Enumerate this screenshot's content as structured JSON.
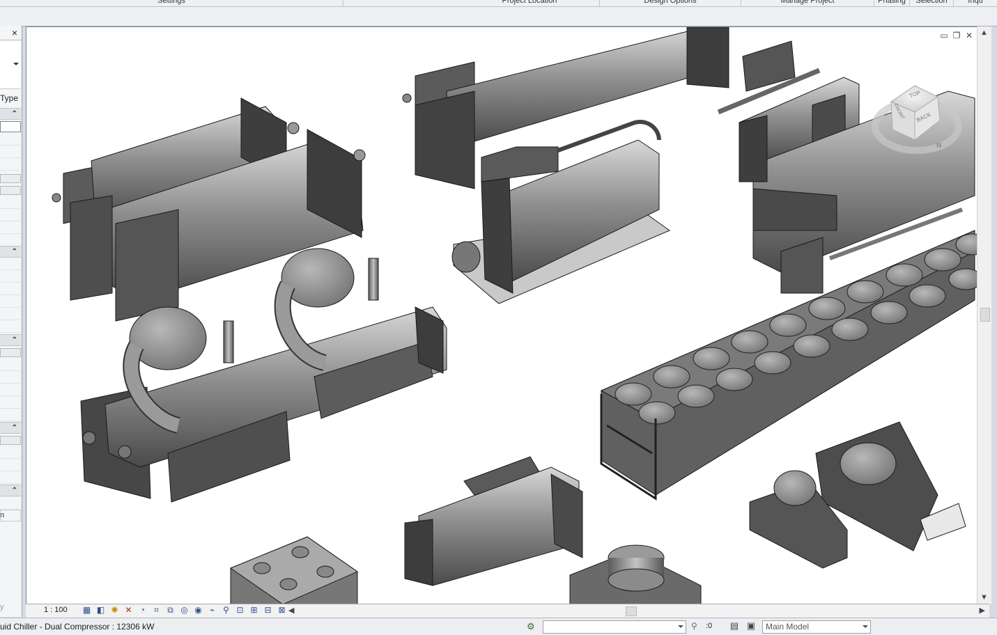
{
  "ribbon": {
    "tabs": [
      "Settings",
      "Project Location",
      "Design Options",
      "Manage Project",
      "Phasing",
      "Selection",
      "Inqu"
    ]
  },
  "properties": {
    "close_label": "×",
    "type_label": "Type",
    "section_toggle": "⌃",
    "partial_value_1": "n",
    "partial_value_2": "y"
  },
  "view": {
    "window_buttons": [
      "▭",
      "❐",
      "✕"
    ],
    "viewcube": {
      "top": "TOP",
      "front": "FRONT",
      "back": "BACK",
      "compass_n": "N"
    },
    "scale": "1 : 100",
    "scroll_up": "▲",
    "scroll_down": "▼",
    "scroll_left": "◀",
    "scroll_right": "▶"
  },
  "view_bar_icons": [
    "detail-level-icon",
    "visual-style-icon",
    "sun-path-icon",
    "shadows-icon",
    "render-icon",
    "crop-view-icon",
    "show-crop-icon",
    "temp-hide-icon",
    "reveal-hidden-icon",
    "lock-3d-icon",
    "analytical-icon",
    "highlight-icon",
    "constraints-icon",
    "worksets-icon",
    "design-options-icon",
    "displacement-icon"
  ],
  "status": {
    "selection_text": "uid Chiller - Dual Compressor : 12306 kW",
    "filter_count": ":0",
    "model_label": "Main Model"
  }
}
